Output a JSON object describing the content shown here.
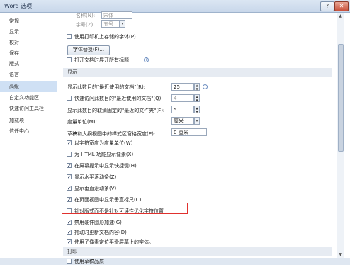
{
  "window": {
    "title": "Word 选项"
  },
  "sidebar": {
    "items": [
      "常规",
      "显示",
      "校对",
      "保存",
      "版式",
      "语言",
      "高级",
      "自定义功能区",
      "快速访问工具栏",
      "加载项",
      "信任中心"
    ]
  },
  "font_section": {
    "name_label": "名称(N):",
    "name_value": "宋体",
    "size_label": "字号(Z):",
    "size_value": "五号",
    "printer_font_label": "使用打印机上存储的字体(P)",
    "substitution_button": "字体替换(F)...",
    "open_with_labels_label": "打开文档时展开所有标题"
  },
  "display_section": {
    "header": "显示",
    "recent_docs_label": "显示此数目的\"最近使用的文档\"(R):",
    "recent_docs_value": "25",
    "quick_access_label": "快速访问此数目的\"最近使用的文档\"(Q):",
    "quick_access_value": "4",
    "unpinned_folders_label": "显示此数目的取消固定的\"最近的文件夹\"(F):",
    "unpinned_folders_value": "5",
    "units_label": "度量单位(M):",
    "units_value": "厘米",
    "style_width_label": "草稿和大纲视图中的样式区窗格宽度(E):",
    "style_width_value": "0 厘米",
    "checkboxes": [
      {
        "label": "以字符宽度为度量单位(W)",
        "checked": true
      },
      {
        "label": "为 HTML 功能显示像素(X)",
        "checked": false
      },
      {
        "label": "在屏幕提示中显示快捷键(H)",
        "checked": true
      },
      {
        "label": "显示水平滚动条(Z)",
        "checked": true
      },
      {
        "label": "显示垂直滚动条(V)",
        "checked": true
      },
      {
        "label": "在页面视图中显示垂直标尺(C)",
        "checked": true
      },
      {
        "label": "针对版式而不是针对可读性优化字符位置",
        "checked": false
      },
      {
        "label": "禁用硬件图形加速(G)",
        "checked": true
      },
      {
        "label": "拖动时更新文档内容(D)",
        "checked": true
      },
      {
        "label": "使用子像素定位平滑屏幕上的字体。",
        "checked": true
      }
    ]
  },
  "print_section": {
    "header": "打印",
    "draft_quality_label": "使用草稿品质"
  }
}
